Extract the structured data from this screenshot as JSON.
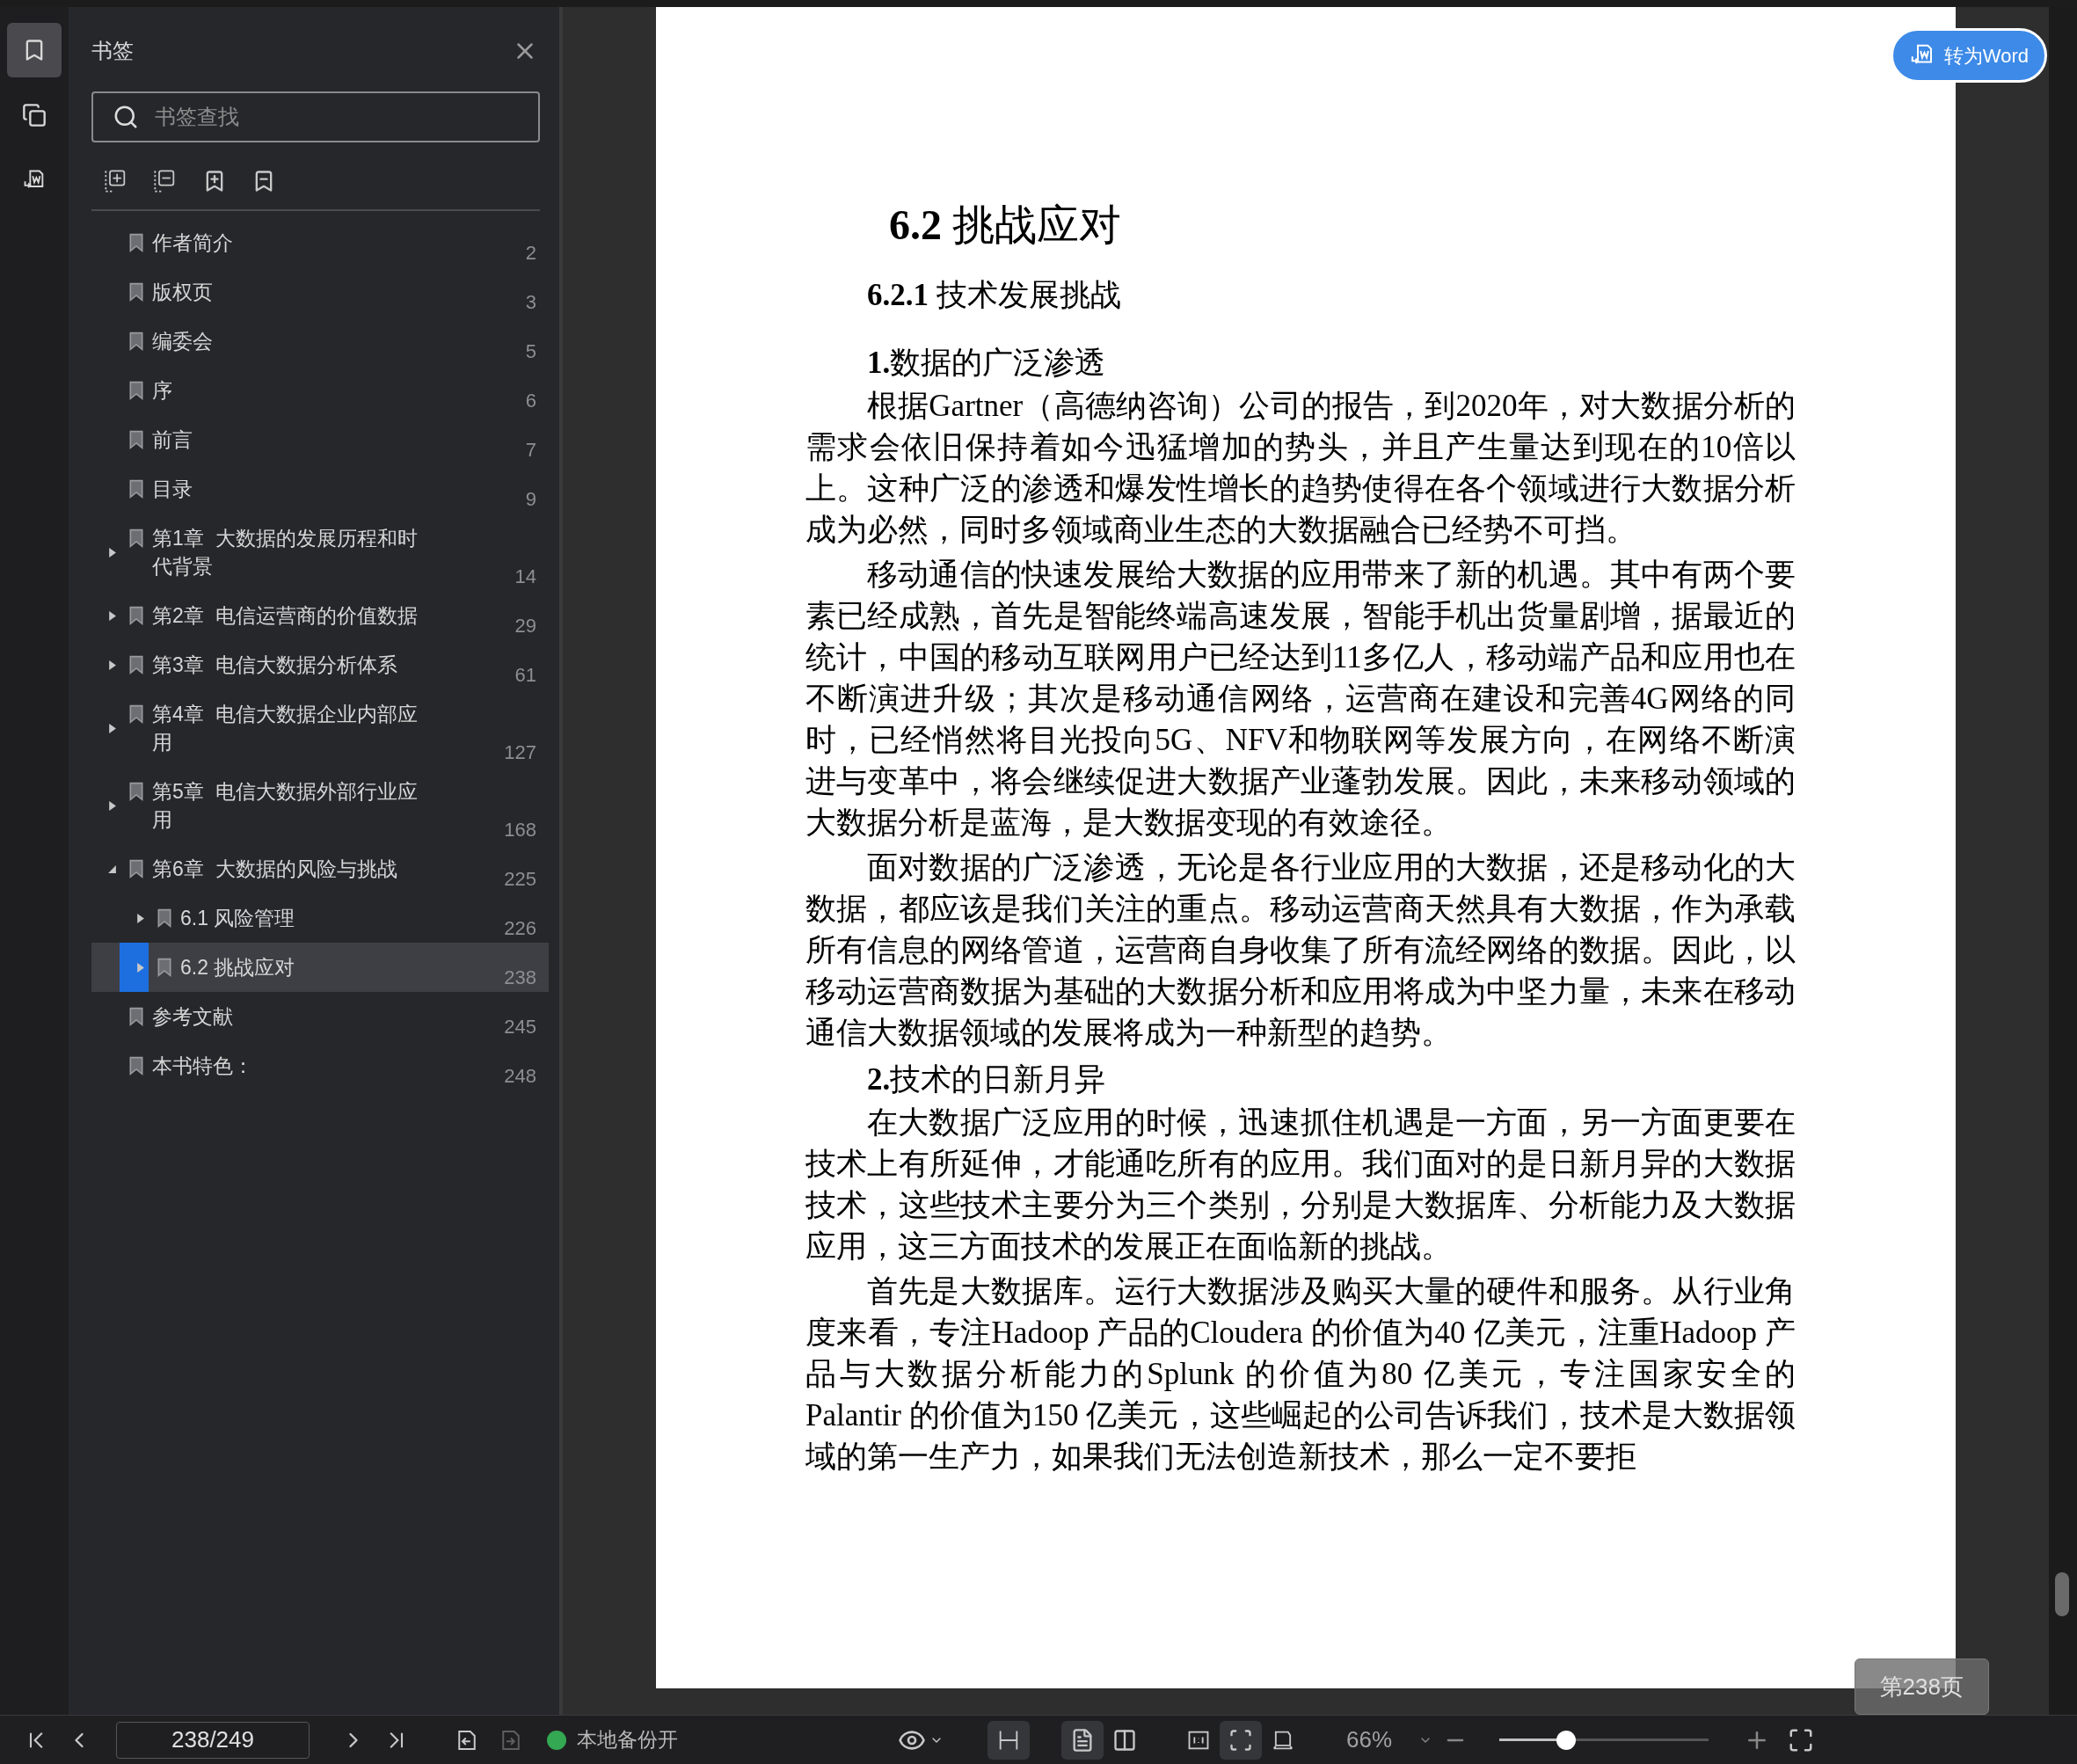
{
  "rail_tabs": [
    {
      "kind": "bookmarks",
      "selected": true
    },
    {
      "kind": "thumbnails",
      "selected": false
    },
    {
      "kind": "convert",
      "selected": false
    }
  ],
  "sidebar": {
    "title": "书签",
    "search": {
      "placeholder": "书签查找"
    },
    "items": [
      {
        "label": "作者简介",
        "page": "2",
        "selected": false
      },
      {
        "label": "版权页",
        "page": "3",
        "selected": false
      },
      {
        "label": "编委会",
        "page": "5",
        "selected": false
      },
      {
        "label": "序",
        "page": "6",
        "selected": false
      },
      {
        "label": "前言",
        "page": "7",
        "selected": false
      },
      {
        "label": "目录",
        "page": "9",
        "selected": false
      },
      {
        "label": "第1章  大数据的发展历程和时代背景",
        "page": "14",
        "selected": false,
        "expanded": false
      },
      {
        "label": "第2章  电信运营商的价值数据",
        "page": "29",
        "selected": false,
        "expanded": false
      },
      {
        "label": "第3章  电信大数据分析体系",
        "page": "61",
        "selected": false,
        "expanded": false
      },
      {
        "label": "第4章  电信大数据企业内部应用",
        "page": "127",
        "selected": false,
        "expanded": false
      },
      {
        "label": "第5章  电信大数据外部行业应用",
        "page": "168",
        "selected": false,
        "expanded": false
      },
      {
        "label": "第6章  大数据的风险与挑战",
        "page": "225",
        "selected": false,
        "expanded": true,
        "children": [
          {
            "label": "6.1 风险管理",
            "page": "226",
            "selected": false,
            "expanded": false
          },
          {
            "label": "6.2 挑战应对",
            "page": "238",
            "selected": true,
            "expanded": false
          }
        ]
      },
      {
        "label": "参考文献",
        "page": "245",
        "selected": false
      },
      {
        "label": "本书特色：",
        "page": "248",
        "selected": false
      }
    ]
  },
  "document": {
    "blocks": [
      {
        "kind": "h1",
        "text": "**6.2** 挑战应对"
      },
      {
        "kind": "h2",
        "text": "**6.2.1** 技术发展挑战"
      },
      {
        "kind": "h3",
        "text": "**1.**数据的广泛渗透"
      },
      {
        "kind": "p",
        "text": "根据Gartner（高德纳咨询）公司的报告，到2020年，对大数据分析的需求会依旧保持着如今迅猛增加的势头，并且产生量达到现在的10倍以上。这种广泛的渗透和爆发性增长的趋势使得在各个领域进行大数据分析成为必然，同时多领域商业生态的大数据融合已经势不可挡。"
      },
      {
        "kind": "p",
        "text": "移动通信的快速发展给大数据的应用带来了新的机遇。其中有两个要素已经成熟，首先是智能终端高速发展，智能手机出货量剧增，据最近的统计，中国的移动互联网用户已经达到11多亿人，移动端产品和应用也在不断演进升级；其次是移动通信网络，运营商在建设和完善4G网络的同时，已经悄然将目光投向5G、NFV和物联网等发展方向，在网络不断演进与变革中，将会继续促进大数据产业蓬勃发展。因此，未来移动领域的大数据分析是蓝海，是大数据变现的有效途径。"
      },
      {
        "kind": "p",
        "text": "面对数据的广泛渗透，无论是各行业应用的大数据，还是移动化的大数据，都应该是我们关注的重点。移动运营商天然具有大数据，作为承载所有信息的网络管道，运营商自身收集了所有流经网络的数据。因此，以移动运营商数据为基础的大数据分析和应用将成为中坚力量，未来在移动通信大数据领域的发展将成为一种新型的趋势。"
      },
      {
        "kind": "h3",
        "text": "**2.**技术的日新月异"
      },
      {
        "kind": "p",
        "text": "在大数据广泛应用的时候，迅速抓住机遇是一方面，另一方面更要在技术上有所延伸，才能通吃所有的应用。我们面对的是日新月异的大数据技术，这些技术主要分为三个类别，分别是大数据库、分析能力及大数据应用，这三方面技术的发展正在面临新的挑战。"
      },
      {
        "kind": "p",
        "text": "首先是大数据库。运行大数据涉及购买大量的硬件和服务。从行业角度来看，专注Hadoop 产品的Cloudera 的价值为40 亿美元，注重Hadoop 产品与大数据分析能力的Splunk 的价值为80 亿美元，专注国家安全的Palantir 的价值为150 亿美元，这些崛起的公司告诉我们，技术是大数据领域的第一生产力，如果我们无法创造新技术，那么一定不要拒"
      }
    ]
  },
  "convert_button": "转为Word",
  "page_badge": "第238页",
  "bottom_bar": {
    "page_field": "238/249",
    "backup": {
      "label": "本地备份开",
      "on": true
    },
    "view_tools": [
      {
        "kind": "continuous",
        "selected": true
      },
      {
        "kind": "single",
        "selected": true
      },
      {
        "kind": "double",
        "selected": false
      },
      {
        "kind": "actual",
        "selected": false
      },
      {
        "kind": "fit-page",
        "selected": true
      },
      {
        "kind": "fit-width",
        "selected": false
      }
    ],
    "zoom": {
      "value": "66%",
      "level": 0.32
    }
  }
}
